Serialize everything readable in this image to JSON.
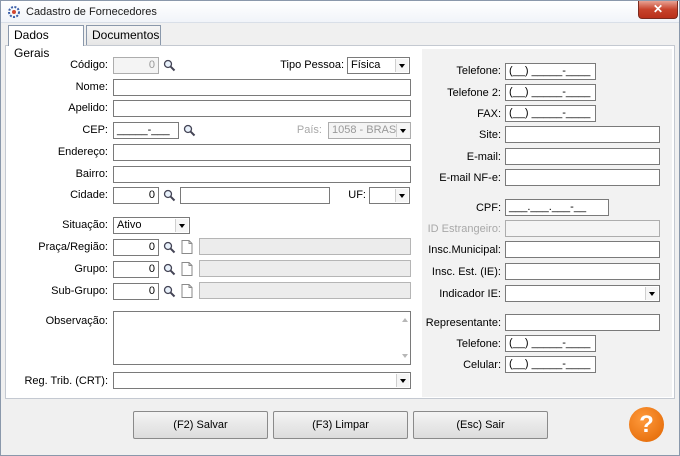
{
  "window": {
    "title": "Cadastro de Fornecedores",
    "close_label": "✕"
  },
  "tabs": [
    {
      "label": "Dados Gerais"
    },
    {
      "label": "Documentos"
    }
  ],
  "left": {
    "codigo": {
      "label": "Código:",
      "value": "0"
    },
    "tipo_pessoa": {
      "label": "Tipo Pessoa:",
      "value": "Física"
    },
    "nome": {
      "label": "Nome:",
      "value": ""
    },
    "apelido": {
      "label": "Apelido:",
      "value": ""
    },
    "cep": {
      "label": "CEP:",
      "value": "_____-___"
    },
    "pais": {
      "label": "País:",
      "value": "1058 - BRASIL"
    },
    "endereco": {
      "label": "Endereço:",
      "value": ""
    },
    "bairro": {
      "label": "Bairro:",
      "value": ""
    },
    "cidade": {
      "label": "Cidade:",
      "value": "0"
    },
    "uf": {
      "label": "UF:",
      "value": ""
    },
    "situacao": {
      "label": "Situação:",
      "value": "Ativo"
    },
    "praca": {
      "label": "Praça/Região:",
      "value": "0"
    },
    "grupo": {
      "label": "Grupo:",
      "value": "0"
    },
    "subgrupo": {
      "label": "Sub-Grupo:",
      "value": "0"
    },
    "observacao": {
      "label": "Observação:",
      "value": ""
    },
    "reg_trib": {
      "label": "Reg. Trib. (CRT):",
      "value": ""
    }
  },
  "right": {
    "telefone": {
      "label": "Telefone:",
      "value": "(__) _____-____"
    },
    "telefone2": {
      "label": "Telefone 2:",
      "value": "(__) _____-____"
    },
    "fax": {
      "label": "FAX:",
      "value": "(__) _____-____"
    },
    "site": {
      "label": "Site:",
      "value": ""
    },
    "email": {
      "label": "E-mail:",
      "value": ""
    },
    "email_nfe": {
      "label": "E-mail NF-e:",
      "value": ""
    },
    "cpf": {
      "label": "CPF:",
      "value": "___.___.___-__"
    },
    "id_estrangeiro": {
      "label": "ID Estrangeiro:",
      "value": ""
    },
    "insc_municipal": {
      "label": "Insc.Municipal:",
      "value": ""
    },
    "insc_est": {
      "label": "Insc. Est. (IE):",
      "value": ""
    },
    "indicador_ie": {
      "label": "Indicador IE:",
      "value": ""
    },
    "representante": {
      "label": "Representante:",
      "value": ""
    },
    "rep_telefone": {
      "label": "Telefone:",
      "value": "(__) _____-____"
    },
    "rep_celular": {
      "label": "Celular:",
      "value": "(__) _____-____"
    }
  },
  "buttons": {
    "salvar": "(F2) Salvar",
    "limpar": "(F3) Limpar",
    "sair": "(Esc) Sair",
    "help": "?"
  },
  "colors": {
    "help_orange": "#e06400",
    "panel_gray": "#f2f2f2",
    "close_red": "#c7422b"
  }
}
